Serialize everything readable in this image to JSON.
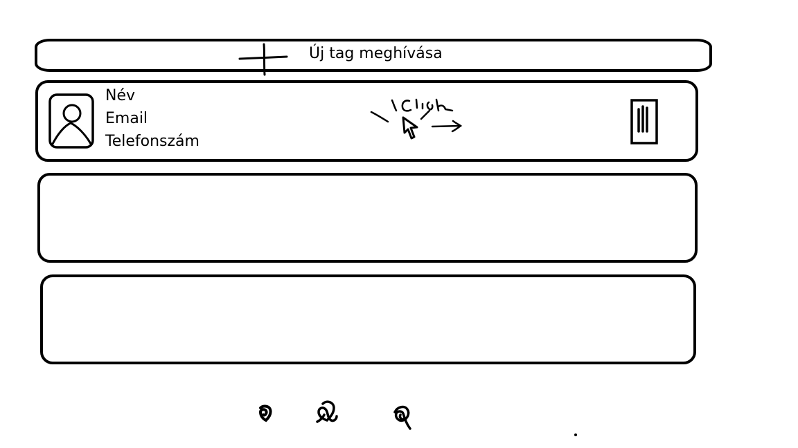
{
  "invite": {
    "label": "Új tag meghívása",
    "icon": "plus-icon"
  },
  "member_cards": [
    {
      "name": "Név",
      "email": "Email",
      "phone": "Telefonszám",
      "avatar_icon": "user-avatar-icon",
      "annotation": "Click",
      "annotation_icon": "cursor-click-icon",
      "action_icon": "trash-icon"
    },
    {},
    {}
  ],
  "bottom_nav": {
    "icons": [
      "nav-icon-1",
      "nav-icon-2",
      "nav-icon-3"
    ]
  }
}
